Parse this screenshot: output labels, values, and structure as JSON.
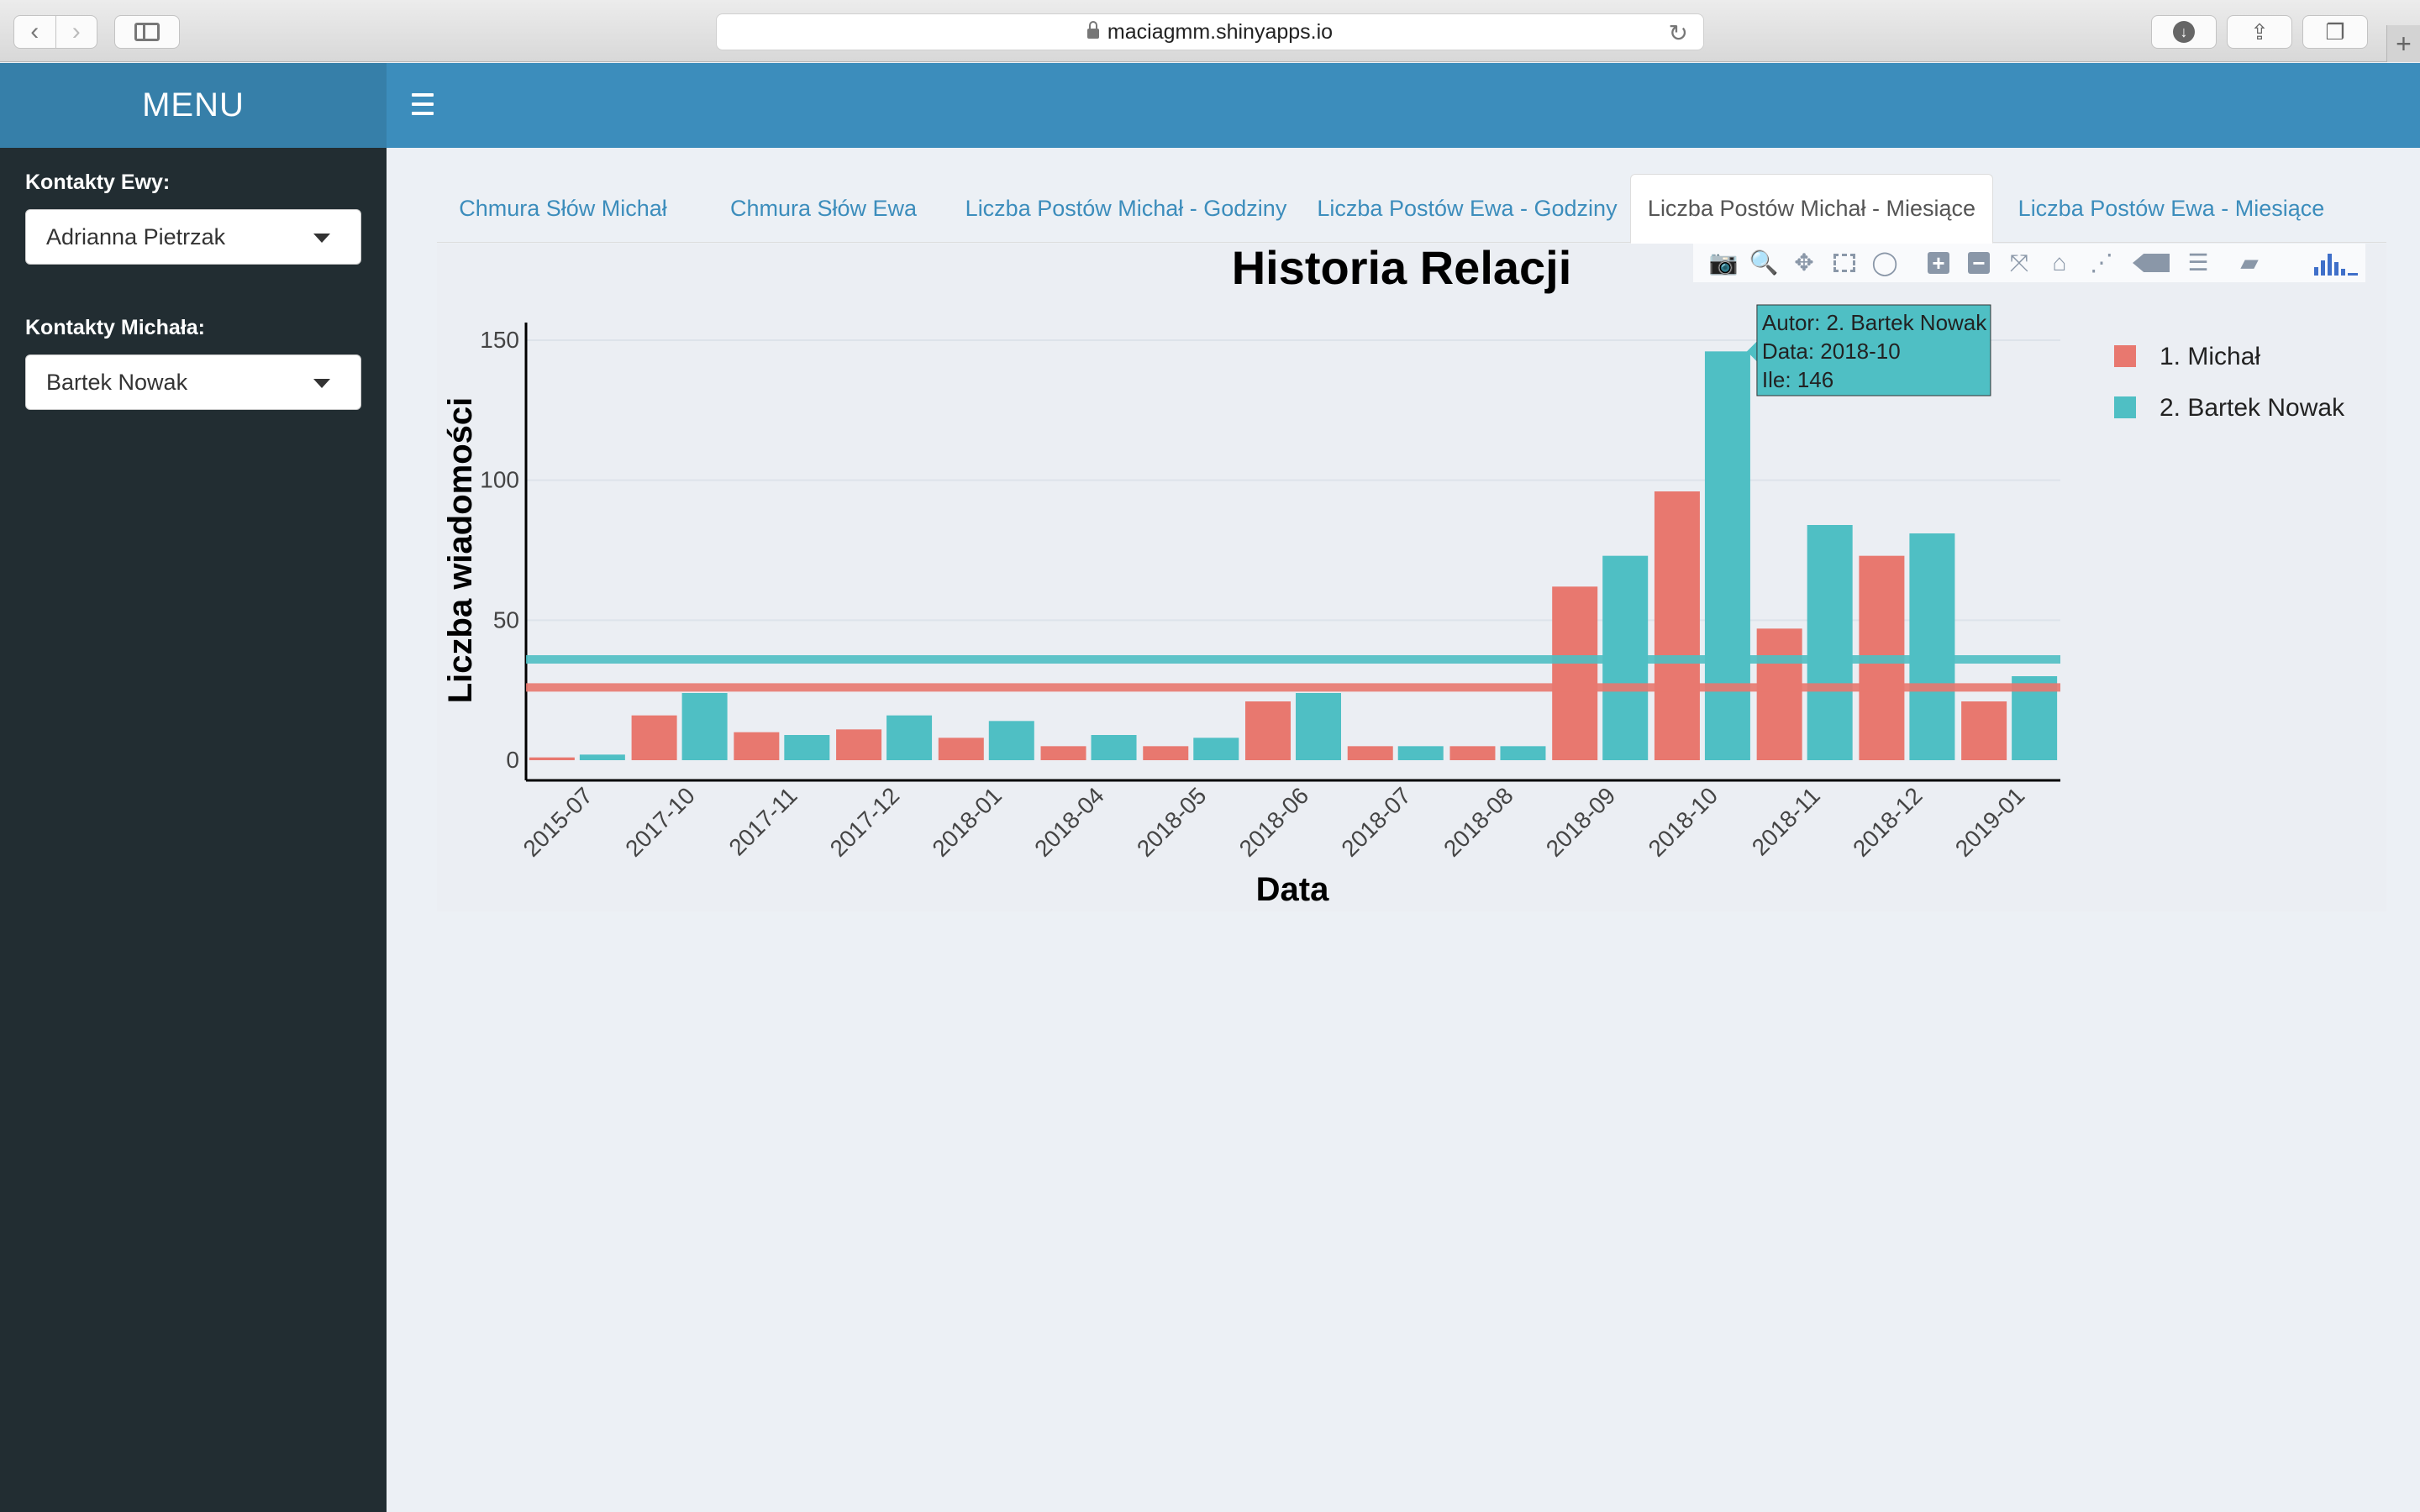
{
  "browser": {
    "url": "maciagmm.shinyapps.io"
  },
  "header": {
    "logo": "MENU"
  },
  "sidebar": {
    "ewa_label": "Kontakty Ewy:",
    "ewa_value": "Adrianna Pietrzak",
    "michal_label": "Kontakty Michała:",
    "michal_value": "Bartek Nowak"
  },
  "tabs": [
    {
      "label": "Chmura Słów Michał",
      "active": false
    },
    {
      "label": "Chmura Słów Ewa",
      "active": false
    },
    {
      "label": "Liczba Postów Michał - Godziny",
      "active": false
    },
    {
      "label": "Liczba Postów Ewa - Godziny",
      "active": false
    },
    {
      "label": "Liczba Postów Michał - Miesiące",
      "active": true
    },
    {
      "label": "Liczba Postów Ewa - Miesiące",
      "active": false
    }
  ],
  "modebar_icons": [
    "camera-icon",
    "zoom-icon",
    "pan-icon",
    "box-select-icon",
    "lasso-select-icon",
    "zoom-in-icon",
    "zoom-out-icon",
    "autoscale-icon",
    "reset-axes-icon",
    "spike-lines-icon",
    "hover-closest-icon",
    "hover-compare-icon",
    "edit-chart-icon",
    "plotly-logo-icon"
  ],
  "chart_data": {
    "type": "bar",
    "title": "Historia Relacji",
    "xlabel": "Data",
    "ylabel": "Liczba wiadomości",
    "ylim": [
      0,
      150
    ],
    "yticks": [
      0,
      50,
      100,
      150
    ],
    "categories": [
      "2015-07",
      "2017-10",
      "2017-11",
      "2017-12",
      "2018-01",
      "2018-04",
      "2018-05",
      "2018-06",
      "2018-07",
      "2018-08",
      "2018-09",
      "2018-10",
      "2018-11",
      "2018-12",
      "2019-01"
    ],
    "series": [
      {
        "name": "1. Michał",
        "color": "#e8786f",
        "values": [
          1,
          16,
          10,
          11,
          8,
          5,
          5,
          21,
          5,
          5,
          62,
          96,
          47,
          73,
          21
        ],
        "mean": 26
      },
      {
        "name": "2. Bartek Nowak",
        "color": "#4fbfc4",
        "values": [
          2,
          24,
          9,
          16,
          14,
          9,
          8,
          24,
          5,
          5,
          73,
          146,
          84,
          81,
          30
        ],
        "mean": 36
      }
    ],
    "legend_position": "top-right",
    "grid": true,
    "tooltip": {
      "series_index": 1,
      "category_index": 11,
      "lines": [
        "Autor: 2. Bartek Nowak",
        "Data: 2018-10",
        "Ile: 146"
      ]
    }
  }
}
